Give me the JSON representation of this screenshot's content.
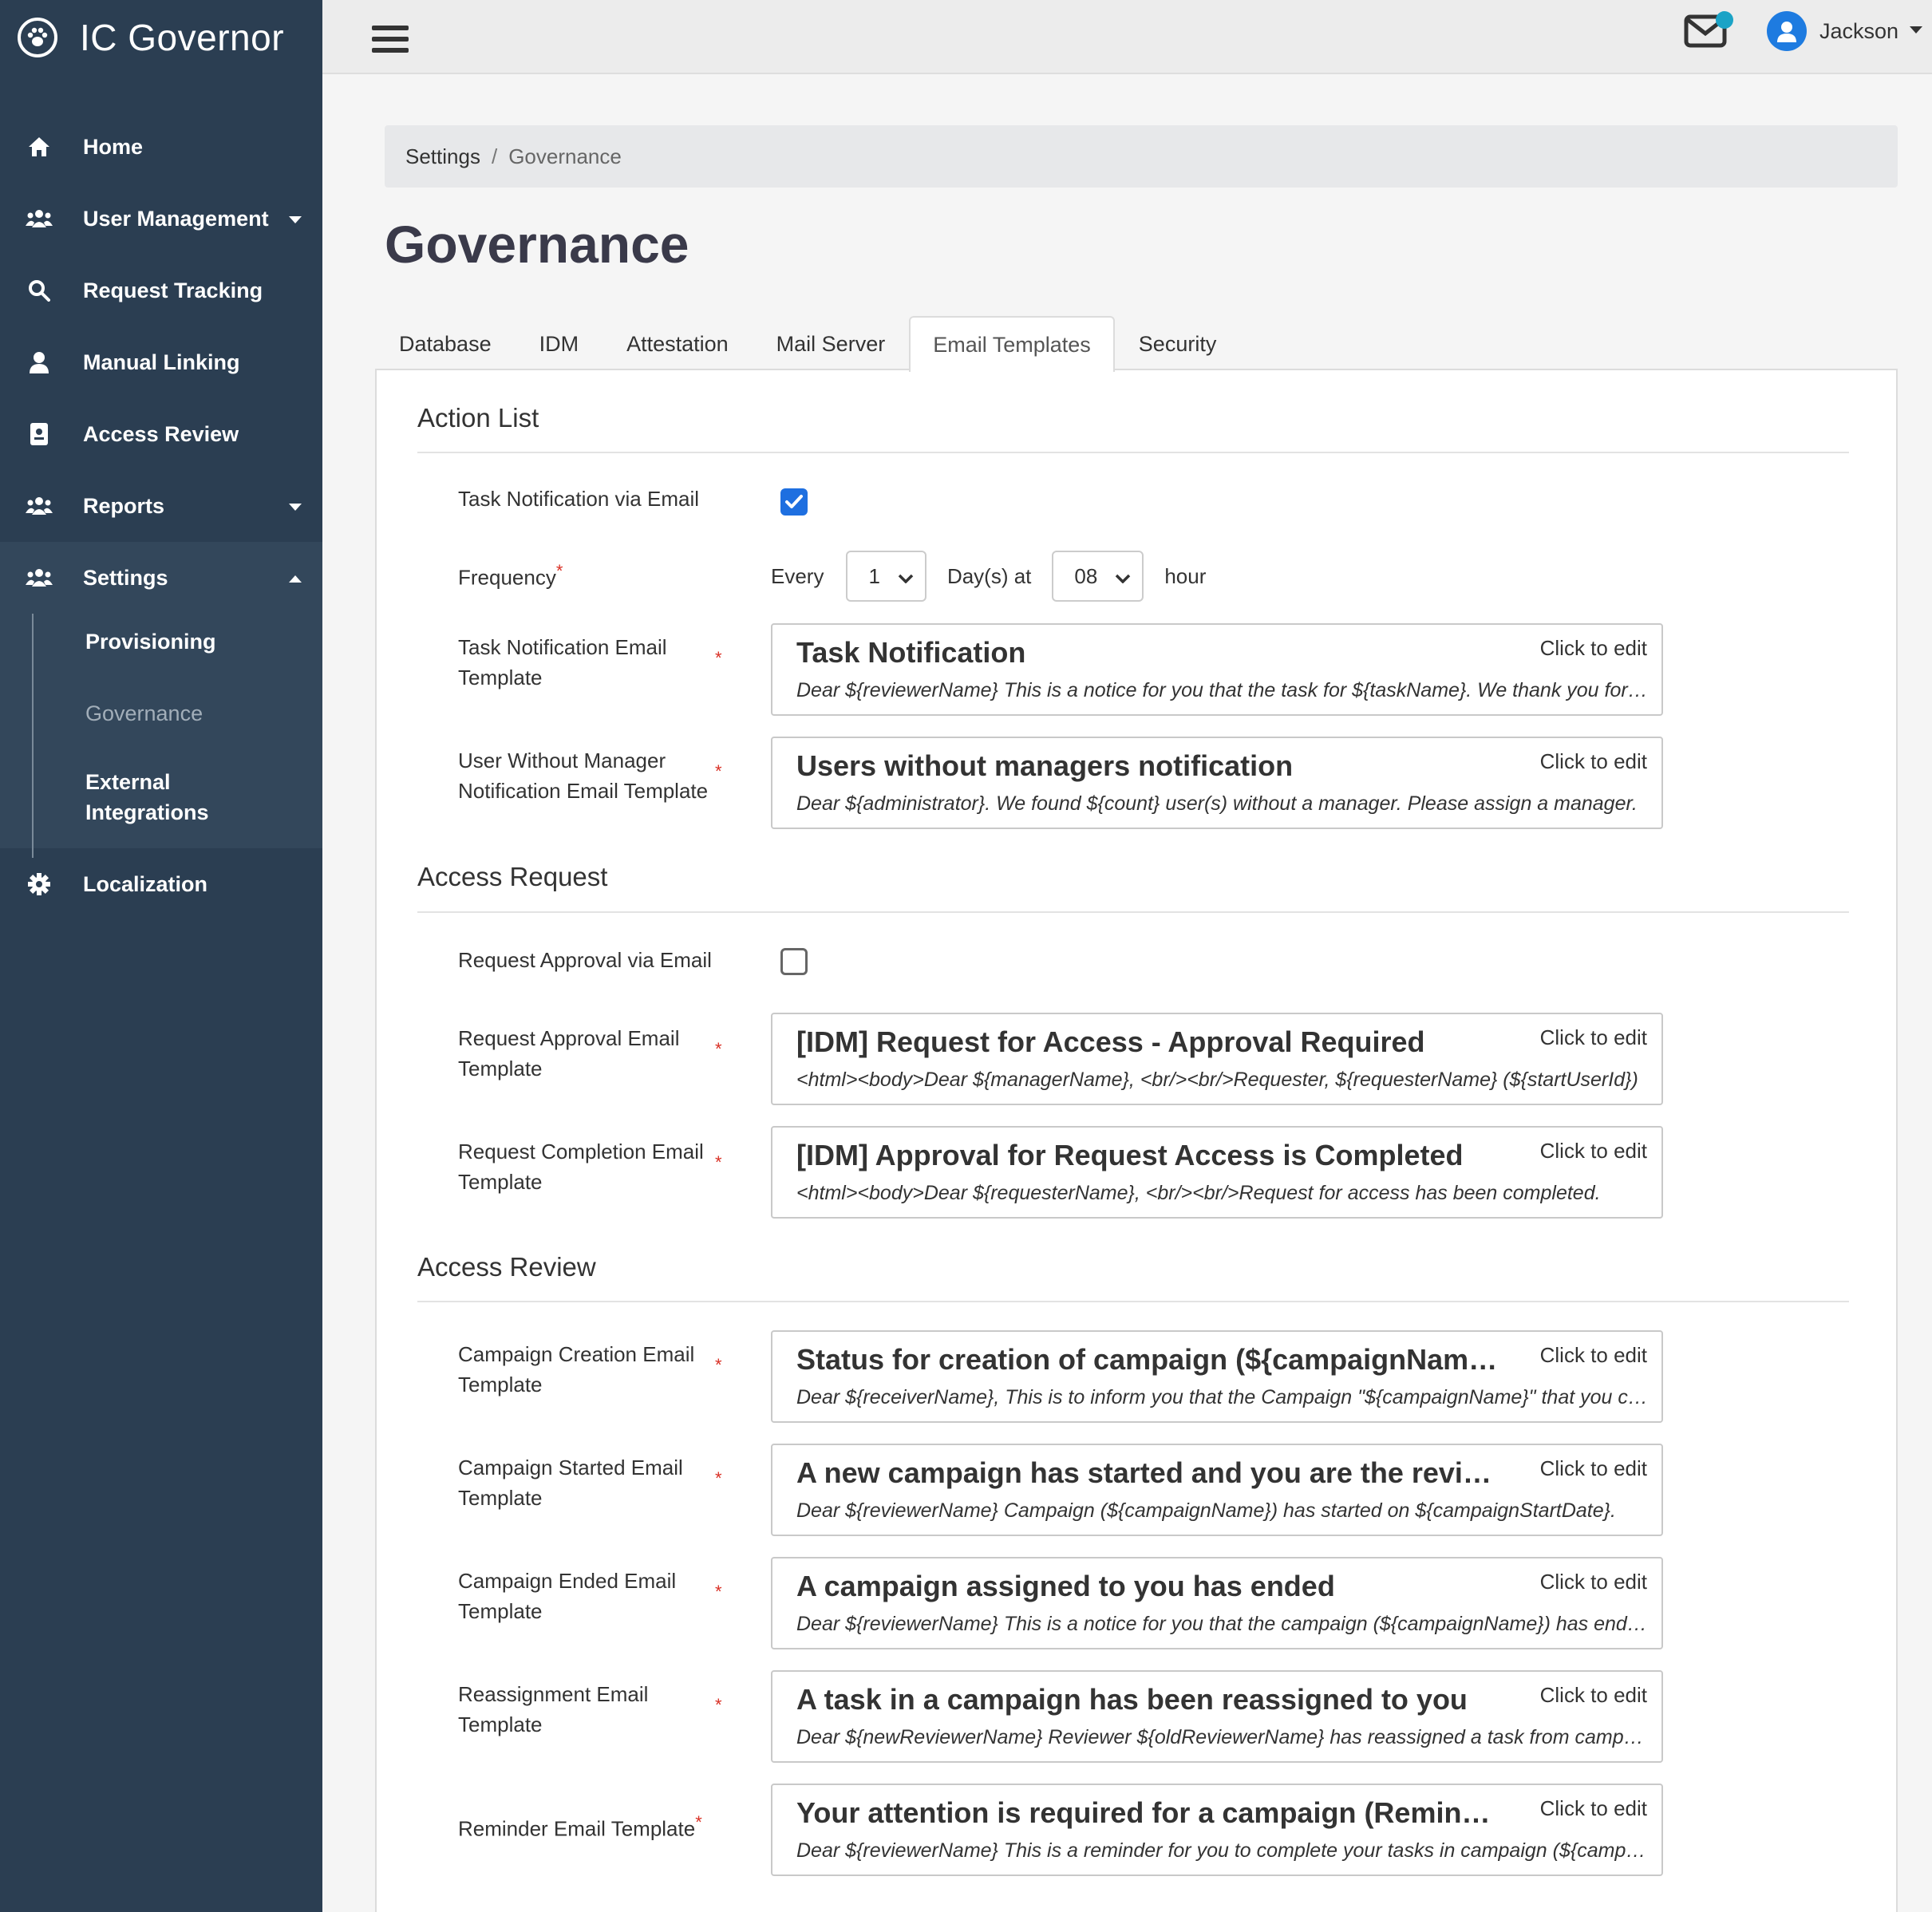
{
  "app": {
    "title": "IC Governor"
  },
  "sidebar": {
    "items": [
      {
        "label": "Home"
      },
      {
        "label": "User Management"
      },
      {
        "label": "Request Tracking"
      },
      {
        "label": "Manual Linking"
      },
      {
        "label": "Access Review"
      },
      {
        "label": "Reports"
      },
      {
        "label": "Settings"
      },
      {
        "label": "Localization"
      }
    ],
    "settings_sub": [
      {
        "label": "Provisioning"
      },
      {
        "label": "Governance"
      },
      {
        "label": "External Integrations"
      }
    ]
  },
  "topbar": {
    "user_name": "Jackson"
  },
  "breadcrumb": {
    "parent": "Settings",
    "separator": "/",
    "current": "Governance"
  },
  "page": {
    "title": "Governance"
  },
  "tabs": [
    {
      "label": "Database"
    },
    {
      "label": "IDM"
    },
    {
      "label": "Attestation"
    },
    {
      "label": "Mail Server"
    },
    {
      "label": "Email Templates"
    },
    {
      "label": "Security"
    }
  ],
  "action_list": {
    "title": "Action List",
    "task_notification_label": "Task Notification via Email",
    "task_notification_checked": true,
    "frequency": {
      "label": "Frequency",
      "every": "Every",
      "days_value": "1",
      "days_at": "Day(s) at",
      "hour_value": "08",
      "hour": "hour"
    }
  },
  "access_request": {
    "title": "Access Request",
    "request_approval_label": "Request Approval via Email",
    "request_approval_checked": false
  },
  "access_review": {
    "title": "Access Review"
  },
  "edit_label": "Click to edit",
  "templates": [
    {
      "label": "Task Notification Email Template",
      "subject": "Task Notification",
      "body": "Dear ${reviewerName} This is a notice for you that the task for ${taskName}. We thank you for your attention."
    },
    {
      "label": "User Without Manager Notification Email Template",
      "subject": "Users without managers notification",
      "body": "Dear ${administrator}. We found ${count} user(s) without a manager. Please assign a manager."
    },
    {
      "label": "Request Approval Email Template",
      "subject": "[IDM] Request for Access - Approval Required",
      "body": "<html><body>Dear ${managerName}, <br/><br/>Requester, ${requesterName} (${startUserId})"
    },
    {
      "label": "Request Completion Email Template",
      "subject": "[IDM] Approval for Request Access is Completed",
      "body": "<html><body>Dear ${requesterName}, <br/><br/>Request for access has been completed."
    },
    {
      "label": "Campaign Creation Email Template",
      "subject": "Status for creation of campaign (${campaignName})",
      "body": "Dear ${receiverName}, This is to inform you that the Campaign \"${campaignName}\" that you created"
    },
    {
      "label": "Campaign Started Email Template",
      "subject": "A new campaign has started and you are the reviewer",
      "body": "Dear ${reviewerName} Campaign (${campaignName}) has started on ${campaignStartDate}."
    },
    {
      "label": "Campaign Ended Email Template",
      "subject": "A campaign assigned to you has ended",
      "body": "Dear ${reviewerName} This is a notice for you that the campaign (${campaignName}) has ended."
    },
    {
      "label": "Reassignment Email Template",
      "subject": "A task in a campaign has been reassigned to you",
      "body": "Dear ${newReviewerName} Reviewer ${oldReviewerName} has reassigned a task from campaign"
    },
    {
      "label": "Reminder Email Template",
      "subject": "Your attention is required for a campaign (Reminder)",
      "body": "Dear ${reviewerName} This is a reminder for you to complete your tasks in campaign (${campaignName})"
    }
  ],
  "colors": {
    "sidebar_bg": "#2b3e52",
    "accent": "#1e6fe0",
    "required": "#d93025",
    "notification_dot": "#1ba3c6"
  }
}
